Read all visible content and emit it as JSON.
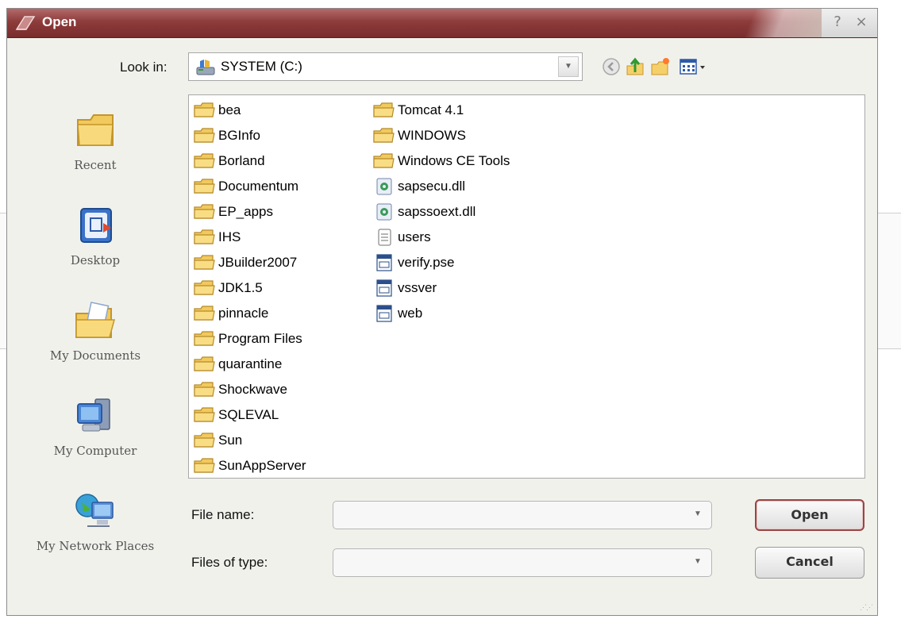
{
  "window": {
    "title": "Open",
    "help_glyph": "?",
    "close_glyph": "×"
  },
  "look_in": {
    "label": "Look in:",
    "value": "SYSTEM (C:)",
    "icon": "drive-icon"
  },
  "toolbar": {
    "icons": [
      "back-icon",
      "up-folder-icon",
      "new-folder-icon",
      "view-menu-icon"
    ]
  },
  "places": [
    {
      "label": "Recent",
      "icon": "recent-folder-icon"
    },
    {
      "label": "Desktop",
      "icon": "desktop-icon"
    },
    {
      "label": "My Documents",
      "icon": "my-documents-icon"
    },
    {
      "label": "My Computer",
      "icon": "my-computer-icon"
    },
    {
      "label": "My Network Places",
      "icon": "network-places-icon"
    }
  ],
  "files_col1": [
    {
      "name": "bea",
      "type": "folder"
    },
    {
      "name": "BGInfo",
      "type": "folder"
    },
    {
      "name": "Borland",
      "type": "folder"
    },
    {
      "name": "Documentum",
      "type": "folder"
    },
    {
      "name": "EP_apps",
      "type": "folder"
    },
    {
      "name": "IHS",
      "type": "folder"
    },
    {
      "name": "JBuilder2007",
      "type": "folder"
    },
    {
      "name": "JDK1.5",
      "type": "folder"
    },
    {
      "name": "pinnacle",
      "type": "folder"
    },
    {
      "name": "Program Files",
      "type": "folder"
    },
    {
      "name": "quarantine",
      "type": "folder"
    },
    {
      "name": "Shockwave",
      "type": "folder"
    },
    {
      "name": "SQLEVAL",
      "type": "folder"
    },
    {
      "name": "Sun",
      "type": "folder"
    },
    {
      "name": "SunAppServer",
      "type": "folder"
    }
  ],
  "files_col2": [
    {
      "name": "Tomcat 4.1",
      "type": "folder"
    },
    {
      "name": "WINDOWS",
      "type": "folder"
    },
    {
      "name": "Windows CE Tools",
      "type": "folder"
    },
    {
      "name": "sapsecu.dll",
      "type": "dll"
    },
    {
      "name": "sapssoext.dll",
      "type": "dll"
    },
    {
      "name": "users",
      "type": "text"
    },
    {
      "name": "verify.pse",
      "type": "app"
    },
    {
      "name": "vssver",
      "type": "app"
    },
    {
      "name": "web",
      "type": "app"
    }
  ],
  "file_name": {
    "label": "File name:",
    "value": ""
  },
  "files_of_type": {
    "label": "Files of type:",
    "value": ""
  },
  "buttons": {
    "open": "Open",
    "cancel": "Cancel"
  }
}
